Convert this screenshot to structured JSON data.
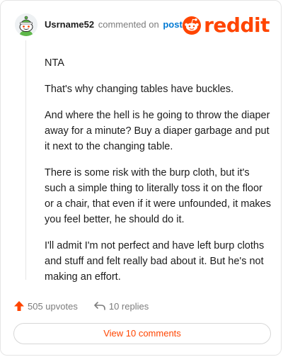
{
  "comment": {
    "username": "Usrname52",
    "commented_text": "commented on",
    "post_link": "post",
    "paragraphs": [
      "NTA",
      "That's why changing tables have buckles.",
      "And where the hell is he going to throw the diaper away for a minute? Buy a diaper garbage and put it next to the changing table.",
      "There is some risk with the burp cloth, but it's such a simple thing to literally toss it on the floor or a chair, that even if it were unfounded, it makes you feel better, he should do it.",
      "I'll admit I'm not perfect and have left burp cloths and stuff and felt really bad about it. But he's not making an effort."
    ]
  },
  "brand": {
    "name": "reddit",
    "color": "#ff4500",
    "icon": "reddit-snoo-icon"
  },
  "actions": {
    "upvotes": "505 upvotes",
    "replies": "10 replies",
    "view_comments": "View 10 comments"
  },
  "colors": {
    "accent": "#ff4500",
    "link": "#0079d3",
    "muted": "#7c7c7c"
  }
}
